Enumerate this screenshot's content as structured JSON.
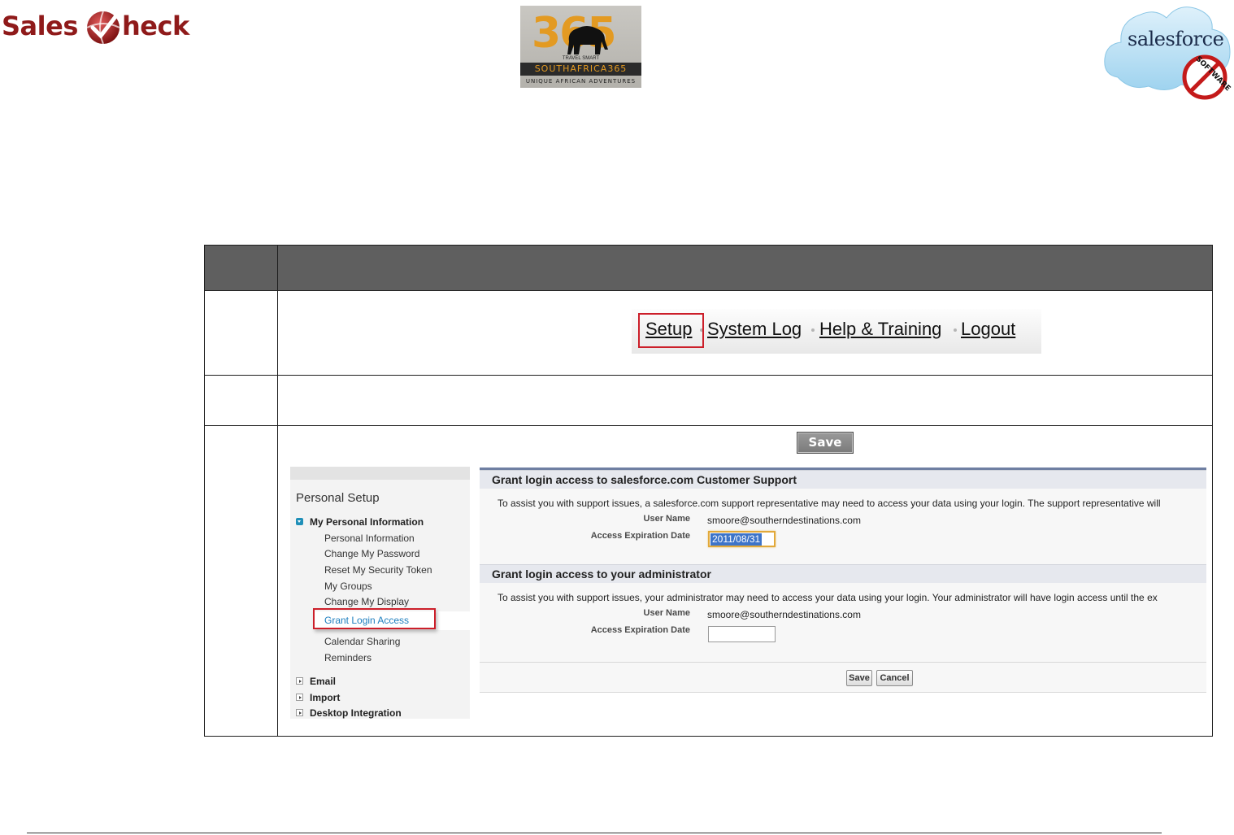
{
  "header": {
    "salescheck_logo": {
      "word_left": "Sales",
      "word_right": "heck"
    },
    "sa365_logo": {
      "number": "365",
      "tagline": "TRAVEL SMART",
      "brand": "SOUTHAFRICA365",
      "subline": "UNIQUE AFRICAN ADVENTURES"
    },
    "salesforce_logo": {
      "wordmark": "salesforce",
      "stamp": "SOFTWARE"
    }
  },
  "toplinks": {
    "items": [
      "Setup",
      "System Log",
      "Help & Training",
      "Logout"
    ],
    "highlighted": "Setup"
  },
  "save_image_label": "Save",
  "sidebar": {
    "title": "Personal Setup",
    "section_open": "My Personal Information",
    "items": [
      "Personal Information",
      "Change My Password",
      "Reset My Security Token",
      "My Groups",
      "Change My Display",
      "Grant Login Access",
      "Calendar Sharing",
      "Reminders"
    ],
    "highlighted": "Grant Login Access",
    "sections_closed": [
      "Email",
      "Import",
      "Desktop Integration"
    ]
  },
  "panel": {
    "section1": {
      "title": "Grant login access to salesforce.com Customer Support",
      "description": "To assist you with support issues, a salesforce.com support representative may need to access your data using your login. The support representative will",
      "user_name_label": "User Name",
      "user_name": "smoore@southerndestinations.com",
      "expiration_label": "Access Expiration Date",
      "expiration_value": "2011/08/31"
    },
    "section2": {
      "title": "Grant login access to your administrator",
      "description": "To assist you with support issues, your administrator may need to access your data using your login. Your administrator will have login access until the ex",
      "user_name_label": "User Name",
      "user_name": "smoore@southerndestinations.com",
      "expiration_label": "Access Expiration Date",
      "expiration_value": ""
    },
    "buttons": {
      "save": "Save",
      "cancel": "Cancel"
    }
  },
  "colors": {
    "brand_red": "#8f1a1a",
    "highlight_red": "#cc1f2a",
    "table_header": "#5f5f5f",
    "link_blue": "#1e7fbf"
  }
}
